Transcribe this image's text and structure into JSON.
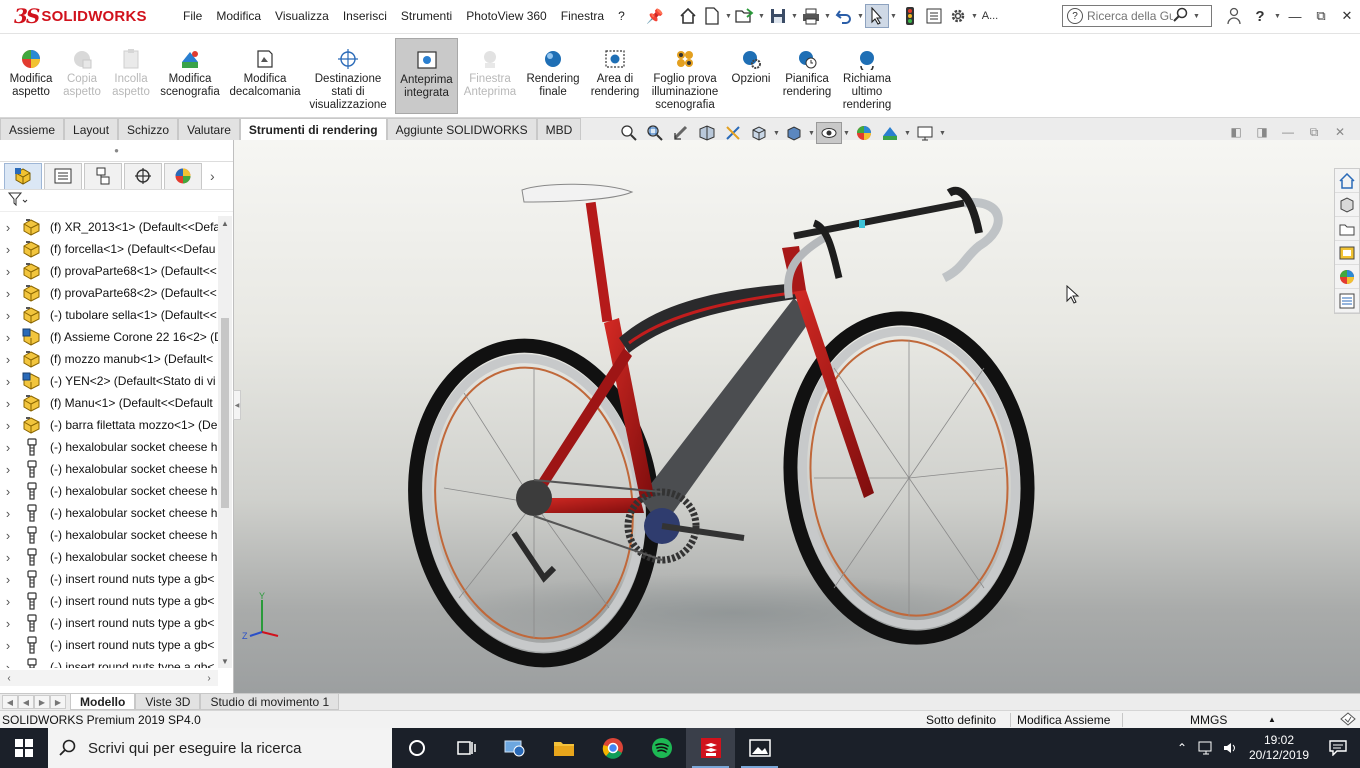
{
  "app": {
    "logo_ds": "3S",
    "logo_text": "SOLIDWORKS",
    "menu": [
      "File",
      "Modifica",
      "Visualizza",
      "Inserisci",
      "Strumenti",
      "PhotoView 360",
      "Finestra",
      "?"
    ],
    "search_placeholder": "Ricerca della Gui",
    "account_label": "A..."
  },
  "ribbon": {
    "buttons": [
      {
        "label": "Modifica aspetto",
        "icon": "edit-appearance-icon",
        "enabled": true
      },
      {
        "label": "Copia aspetto",
        "icon": "copy-appearance-icon",
        "enabled": false
      },
      {
        "label": "Incolla aspetto",
        "icon": "paste-appearance-icon",
        "enabled": false
      },
      {
        "label": "Modifica scenografia",
        "icon": "edit-scene-icon",
        "enabled": true
      },
      {
        "label": "Modifica decalcomania",
        "icon": "edit-decal-icon",
        "enabled": true
      },
      {
        "label": "Destinazione stati di visualizzazione",
        "icon": "display-state-target-icon",
        "enabled": true
      },
      {
        "label": "Anteprima integrata",
        "icon": "integrated-preview-icon",
        "enabled": true,
        "active": true
      },
      {
        "label": "Finestra Anteprima",
        "icon": "preview-window-icon",
        "enabled": false
      },
      {
        "label": "Rendering finale",
        "icon": "final-render-icon",
        "enabled": true
      },
      {
        "label": "Area di rendering",
        "icon": "render-region-icon",
        "enabled": true
      },
      {
        "label": "Foglio prova illuminazione scenografia",
        "icon": "scene-illumination-proof-icon",
        "enabled": true
      },
      {
        "label": "Opzioni",
        "icon": "options-icon",
        "enabled": true
      },
      {
        "label": "Pianifica rendering",
        "icon": "schedule-render-icon",
        "enabled": true
      },
      {
        "label": "Richiama ultimo rendering",
        "icon": "recall-last-render-icon",
        "enabled": true
      }
    ]
  },
  "command_tabs": [
    {
      "label": "Assieme",
      "active": false
    },
    {
      "label": "Layout",
      "active": false
    },
    {
      "label": "Schizzo",
      "active": false
    },
    {
      "label": "Valutare",
      "active": false
    },
    {
      "label": "Strumenti di rendering",
      "active": true
    },
    {
      "label": "Aggiunte SOLIDWORKS",
      "active": false
    },
    {
      "label": "MBD",
      "active": false
    }
  ],
  "feature_tree": [
    {
      "label": "(f) XR_2013<1> (Default<<Defa",
      "icon": "part"
    },
    {
      "label": "(f) forcella<1> (Default<<Defau",
      "icon": "part"
    },
    {
      "label": "(f) provaParte68<1> (Default<<",
      "icon": "part"
    },
    {
      "label": "(f) provaParte68<2> (Default<<",
      "icon": "part"
    },
    {
      "label": "(-) tubolare sella<1> (Default<<",
      "icon": "part"
    },
    {
      "label": "(f) Assieme Corone 22 16<2> (D",
      "icon": "assembly"
    },
    {
      "label": "(f) mozzo manub<1> (Default<",
      "icon": "part"
    },
    {
      "label": "(-) YEN<2> (Default<Stato di vi",
      "icon": "assembly"
    },
    {
      "label": "(f) Manu<1> (Default<<Default",
      "icon": "part"
    },
    {
      "label": "(-) barra filettata mozzo<1> (De",
      "icon": "part"
    },
    {
      "label": "(-) hexalobular socket cheese h",
      "icon": "toolbox"
    },
    {
      "label": "(-) hexalobular socket cheese h",
      "icon": "toolbox"
    },
    {
      "label": "(-) hexalobular socket cheese h",
      "icon": "toolbox"
    },
    {
      "label": "(-) hexalobular socket cheese h",
      "icon": "toolbox"
    },
    {
      "label": "(-) hexalobular socket cheese h",
      "icon": "toolbox"
    },
    {
      "label": "(-) hexalobular socket cheese h",
      "icon": "toolbox"
    },
    {
      "label": "(-) insert round nuts type a gb<",
      "icon": "toolbox"
    },
    {
      "label": "(-) insert round nuts type a gb<",
      "icon": "toolbox"
    },
    {
      "label": "(-) insert round nuts type a gb<",
      "icon": "toolbox"
    },
    {
      "label": "(-) insert round nuts type a gb<",
      "icon": "toolbox"
    },
    {
      "label": "(-) insert round nuts type a gb<",
      "icon": "toolbox"
    }
  ],
  "bottom_tabs": [
    {
      "label": "Modello",
      "active": true
    },
    {
      "label": "Viste 3D",
      "active": false
    },
    {
      "label": "Studio di movimento 1",
      "active": false
    }
  ],
  "status": {
    "product": "SOLIDWORKS Premium 2019 SP4.0",
    "definition": "Sotto definito",
    "mode": "Modifica Assieme",
    "units": "MMGS"
  },
  "triad": {
    "y": "Y",
    "z": "Z"
  },
  "taskbar": {
    "search_placeholder": "Scrivi qui per eseguire la ricerca",
    "apps": [
      "task-view-icon",
      "network-monitor-icon",
      "file-explorer-icon",
      "chrome-icon",
      "spotify-icon",
      "solidworks-icon",
      "photos-icon"
    ],
    "time": "19:02",
    "date": "20/12/2019"
  },
  "colors": {
    "brand_red": "#d1121c",
    "frame_red": "#b01818",
    "taskbar": "#1b2029"
  }
}
